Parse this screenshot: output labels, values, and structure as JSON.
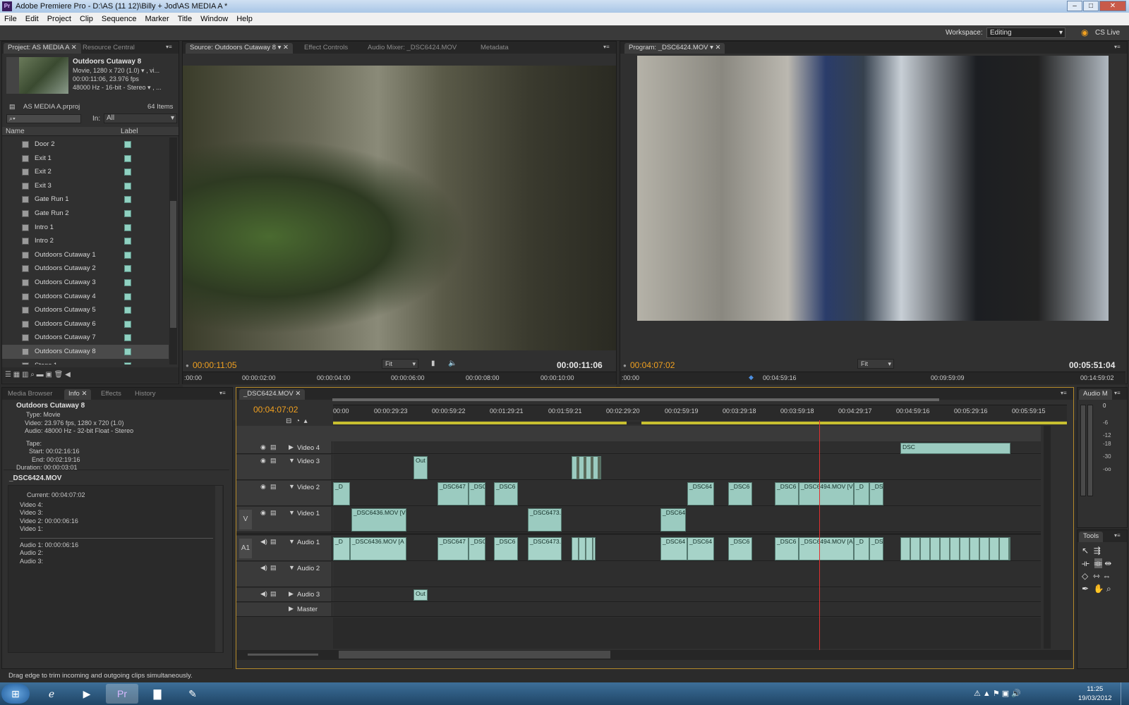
{
  "window": {
    "title": "Adobe Premiere Pro - D:\\AS (11 12)\\Billy + Jod\\AS MEDIA A *",
    "app_icon": "Pr"
  },
  "menu": [
    "File",
    "Edit",
    "Project",
    "Clip",
    "Sequence",
    "Marker",
    "Title",
    "Window",
    "Help"
  ],
  "workspace": {
    "label": "Workspace:",
    "value": "Editing",
    "cs_live": "CS Live"
  },
  "project_panel": {
    "tabs": [
      "Project: AS MEDIA A",
      "Resource Central"
    ],
    "clip_name": "Outdoors Cutaway 8",
    "clip_info": [
      "Movie, 1280 x 720 (1.0)  ▾ , vi...",
      "00:00:11:06, 23.976 fps",
      "48000 Hz - 16-bit - Stereo  ▾ , ..."
    ],
    "project_file": "AS MEDIA A.prproj",
    "item_count": "64 Items",
    "in_label": "In:",
    "in_value": "All",
    "col_name": "Name",
    "col_label": "Label",
    "items": [
      "Door 2",
      "Exit 1",
      "Exit 2",
      "Exit 3",
      "Gate Run 1",
      "Gate Run 2",
      "Intro 1",
      "Intro 2",
      "Outdoors Cutaway 1",
      "Outdoors Cutaway 2",
      "Outdoors Cutaway 3",
      "Outdoors Cutaway 4",
      "Outdoors Cutaway 5",
      "Outdoors Cutaway 6",
      "Outdoors Cutaway 7",
      "Outdoors Cutaway 8",
      "Steps 1"
    ]
  },
  "source_panel": {
    "tabs": [
      "Source: Outdoors Cutaway 8",
      "Effect Controls",
      "Audio Mixer: _DSC6424.MOV",
      "Metadata"
    ],
    "timecode_in": "00:00:11:05",
    "timecode_dur": "00:00:11:06",
    "fit": "Fit",
    "ruler": ":00:00",
    "ruler2": "00:00:02:00",
    "ruler3": "00:00:04:00",
    "ruler4": "00:00:06:00",
    "ruler5": "00:00:08:00",
    "ruler6": "00:00:10:00"
  },
  "program_panel": {
    "tabs": [
      "Program: _DSC6424.MOV"
    ],
    "timecode_in": "00:04:07:02",
    "timecode_dur": "00:05:51:04",
    "fit": "Fit",
    "ruler": ":00:00",
    "ruler2": "00:04:59:16",
    "ruler3": "00:09:59:09",
    "ruler4": "00:14:59:02"
  },
  "info_panel": {
    "tabs": [
      "Media Browser",
      "Info",
      "Effects",
      "History"
    ],
    "clip_name": "Outdoors Cutaway 8",
    "type": "Type: Movie",
    "video": "Video: 23.976 fps, 1280 x 720 (1.0)",
    "audio": "Audio: 48000 Hz - 32-bit Float - Stereo",
    "tape": "Tape:",
    "start": "Start: 00:02:16:16",
    "end": "End: 00:02:19:16",
    "duration": "Duration: 00:00:03:01",
    "seq_name": "_DSC6424.MOV",
    "current": "Current: 00:04:07:02",
    "video4": "Video 4:",
    "video3": "Video 3:",
    "video2": "Video 2: 00:00:06:16",
    "video1": "Video 1:",
    "audio1": "Audio 1: 00:00:06:16",
    "audio2": "Audio 2:",
    "audio3": "Audio 3:"
  },
  "timeline": {
    "tab": "_DSC6424.MOV",
    "timecode": "00:04:07:02",
    "ruler": [
      "00:00",
      "00:00:29:23",
      "00:00:59:22",
      "00:01:29:21",
      "00:01:59:21",
      "00:02:29:20",
      "00:02:59:19",
      "00:03:29:18",
      "00:03:59:18",
      "00:04:29:17",
      "00:04:59:16",
      "00:05:29:16",
      "00:05:59:15"
    ],
    "tracks": {
      "v4": "Video 4",
      "v3": "Video 3",
      "v2": "Video 2",
      "v1": "Video 1",
      "a1": "Audio 1",
      "a2": "Audio 2",
      "a3": "Audio 3",
      "master": "Master"
    },
    "src_v": "V",
    "src_a": "A1",
    "clip_v1a": "_DSC6436.MOV [V",
    "clip_v1b": "_DSC6473.",
    "clip_v1c": "_DSC64",
    "clip_v2a": "_D",
    "clip_v2b": "_DSC647",
    "clip_v2c": "_DSC",
    "clip_v2d": "_DSC6",
    "clip_v2e": "_DSC64",
    "clip_v2f": "_DSC6",
    "clip_v2g": "_DSC6",
    "clip_v2h": "_DSC6494.MOV [V",
    "clip_v2i": "_D",
    "clip_v2j": "_DSC",
    "clip_v3a": "Out",
    "clip_a1a": "_D",
    "clip_a1b": "_DSC6436.MOV [A",
    "clip_a1c": "_DSC647",
    "clip_a1d": "_DSC",
    "clip_a1e": "_DSC6",
    "clip_a1f": "_DSC6473.",
    "clip_a1g": "_DSC64",
    "clip_a1h": "_DSC64",
    "clip_a1i": "_DSC6",
    "clip_a1j": "_DSC6",
    "clip_a1k": "_DSC6494.MOV [A",
    "clip_a1l": "_D",
    "clip_a1m": "_DSC",
    "clip_a3a": "Out",
    "clip_v4": "DSC"
  },
  "audio_meter": {
    "title": "Audio M",
    "scale": [
      "0",
      "-6",
      "-12",
      "-18",
      "-30",
      "-oo"
    ]
  },
  "tools": {
    "title": "Tools"
  },
  "status": "Drag edge to trim incoming and outgoing clips simultaneously.",
  "tray": {
    "time": "11:25",
    "date": "19/03/2012"
  }
}
